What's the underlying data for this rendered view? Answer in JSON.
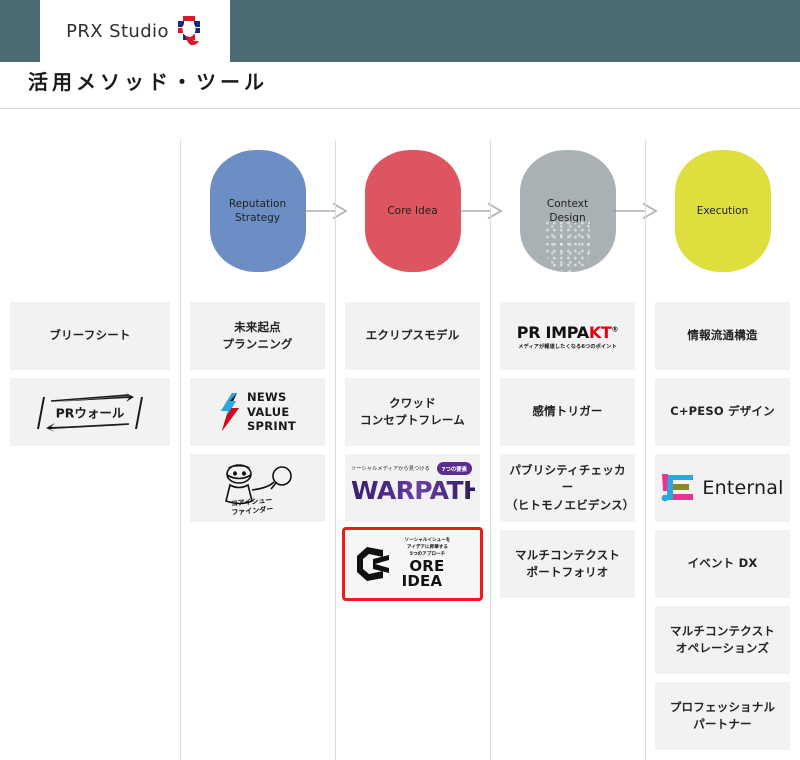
{
  "header": {
    "logo_text": "PRX Studio",
    "logo_mark": "q-logo-icon",
    "bar_color": "#4d6b73"
  },
  "page_title": "活用メソッド・ツール",
  "flow": {
    "arrow_icon": "arrow-right-icon",
    "stages": [
      {
        "label": "",
        "color": ""
      },
      {
        "label": "Reputation\nStrategy",
        "color": "#6c8ec4",
        "shape": "squircle"
      },
      {
        "label": "Core Idea",
        "color": "#dd5560",
        "shape": "squircle"
      },
      {
        "label": "Context\nDesign",
        "color": "#a9b1b5",
        "shape": "squircle"
      },
      {
        "label": "Execution",
        "color": "#dede3f",
        "shape": "squircle"
      }
    ]
  },
  "highlight_color": "#ee1c18",
  "columns": [
    {
      "name": "column-1",
      "cards": [
        {
          "type": "text",
          "label": "ブリーフシート"
        },
        {
          "type": "logo-prwall",
          "label": "PRウォール"
        }
      ]
    },
    {
      "name": "column-2",
      "cards": [
        {
          "type": "text",
          "label": "未来起点\nプランニング"
        },
        {
          "type": "logo-nvs",
          "label": "NEWS\nVALUE\nSPRINT"
        },
        {
          "type": "logo-cif",
          "label": "コアイシュー\nファインダー"
        }
      ]
    },
    {
      "name": "column-3",
      "cards": [
        {
          "type": "text",
          "label": "エクリプスモデル"
        },
        {
          "type": "text",
          "label": "クワッド\nコンセプトフレーム"
        },
        {
          "type": "logo-warpath",
          "label": "WARPATH",
          "sub": "ソーシャルメディアから見つける",
          "badge": "7つの要素"
        },
        {
          "type": "logo-coreidea",
          "label": "ORE",
          "label2": "IDEA",
          "sub": "ソーシャルイシューを\nアイデアに昇華する\n5つのアプローチ",
          "highlight": true
        }
      ]
    },
    {
      "name": "column-4",
      "cards": [
        {
          "type": "logo-impakt",
          "label": "PR IMPA",
          "label_accent": "KT",
          "sub": "メディアが報道したくなる6つのポイント"
        },
        {
          "type": "text",
          "label": "感情トリガー"
        },
        {
          "type": "text",
          "label": "パブリシティチェッカー\n（ヒトモノエビデンス）"
        },
        {
          "type": "text",
          "label": "マルチコンテクスト\nポートフォリオ"
        }
      ]
    },
    {
      "name": "column-5",
      "cards": [
        {
          "type": "text",
          "label": "情報流通構造"
        },
        {
          "type": "text",
          "label": "C+PESO デザイン"
        },
        {
          "type": "logo-enternal",
          "label": "Enternal"
        },
        {
          "type": "text",
          "label": "イベント DX"
        },
        {
          "type": "text",
          "label": "マルチコンテクスト\nオペレーションズ"
        },
        {
          "type": "text",
          "label": "プロフェッショナル\nパートナー"
        }
      ]
    }
  ]
}
